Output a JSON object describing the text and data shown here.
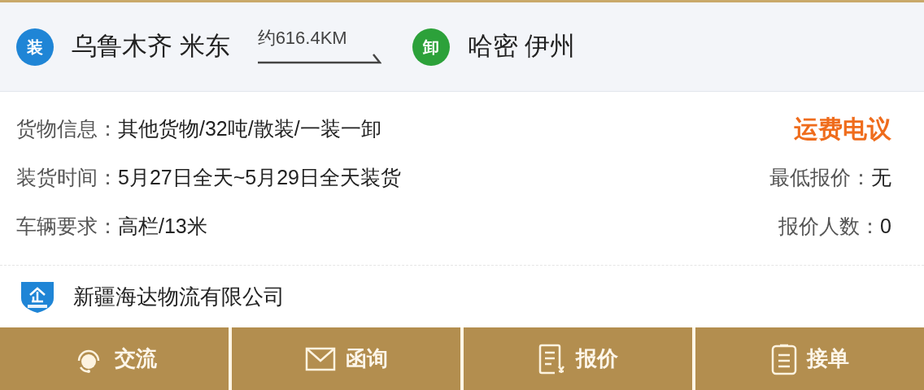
{
  "route": {
    "origin": {
      "badge": "装",
      "place": "乌鲁木齐 米东"
    },
    "distance": "约616.4KM",
    "destination": {
      "badge": "卸",
      "place": "哈密 伊州"
    }
  },
  "details": [
    {
      "label": "货物信息：",
      "value": "其他货物/32吨/散装/一装一卸"
    },
    {
      "label": "装货时间：",
      "value": "5月27日全天~5月29日全天装货"
    },
    {
      "label": "车辆要求：",
      "value": "高栏/13米"
    }
  ],
  "price_note": "运费电议",
  "stats": [
    {
      "label": "最低报价：",
      "value": "无"
    },
    {
      "label": "报价人数：",
      "value": "0"
    }
  ],
  "company": {
    "name": "新疆海达物流有限公司"
  },
  "actions": [
    {
      "kind": "chat",
      "label": "交流"
    },
    {
      "kind": "mail",
      "label": "函询"
    },
    {
      "kind": "quote",
      "label": "报价"
    },
    {
      "kind": "accept",
      "label": "接单"
    }
  ]
}
